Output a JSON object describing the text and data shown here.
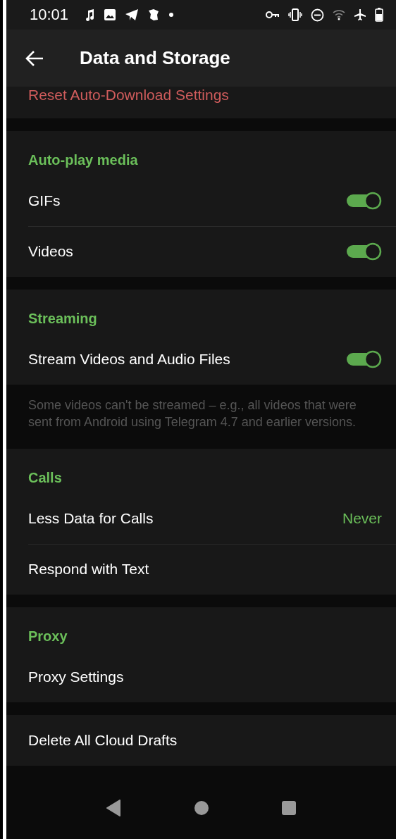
{
  "status_bar": {
    "time": "10:01"
  },
  "app_bar": {
    "title": "Data and Storage"
  },
  "sections": [
    {
      "rows": [
        {
          "kind": "danger",
          "label": "Reset Auto-Download Settings"
        }
      ]
    },
    {
      "header": "Auto-play media",
      "rows": [
        {
          "kind": "toggle",
          "label": "GIFs",
          "on": true
        },
        {
          "kind": "toggle",
          "label": "Videos",
          "on": true
        }
      ]
    },
    {
      "header": "Streaming",
      "rows": [
        {
          "kind": "toggle",
          "label": "Stream Videos and Audio Files",
          "on": true
        }
      ],
      "footer": "Some videos can't be streamed – e.g., all videos that were sent from Android using Telegram 4.7 and earlier versions."
    },
    {
      "header": "Calls",
      "rows": [
        {
          "kind": "value",
          "label": "Less Data for Calls",
          "value": "Never"
        },
        {
          "kind": "plain",
          "label": "Respond with Text"
        }
      ]
    },
    {
      "header": "Proxy",
      "rows": [
        {
          "kind": "plain",
          "label": "Proxy Settings"
        }
      ]
    },
    {
      "rows": [
        {
          "kind": "plain",
          "label": "Delete All Cloud Drafts"
        }
      ]
    }
  ]
}
